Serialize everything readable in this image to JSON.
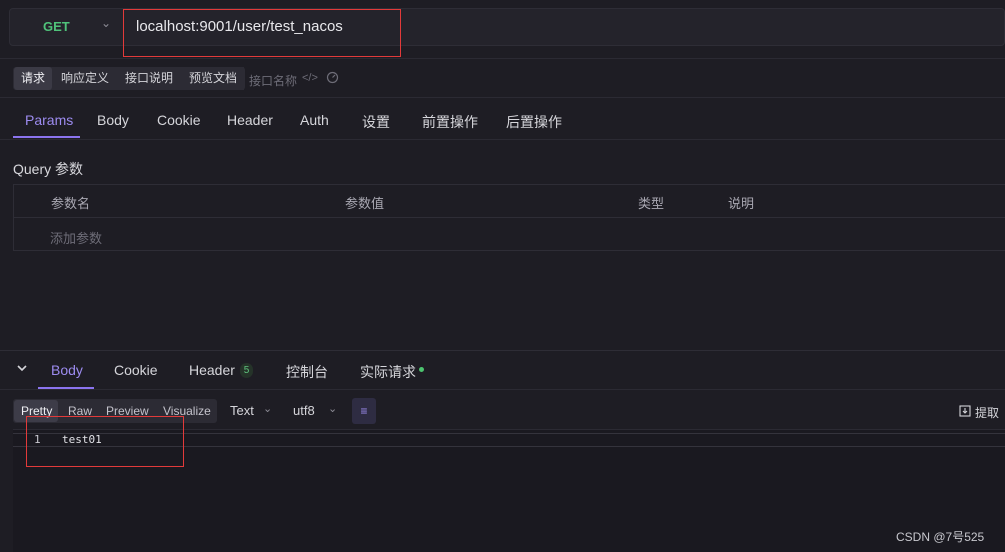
{
  "request": {
    "method": "GET",
    "url": "localhost:9001/user/test_nacos"
  },
  "subtabs": [
    "请求",
    "响应定义",
    "接口说明",
    "预览文档"
  ],
  "name_placeholder": "接口名称",
  "tabs": [
    "Params",
    "Body",
    "Cookie",
    "Header",
    "Auth",
    "设置",
    "前置操作",
    "后置操作"
  ],
  "query": {
    "title": "Query 参数",
    "columns": [
      "参数名",
      "参数值",
      "类型",
      "说明"
    ],
    "add_placeholder": "添加参数"
  },
  "response": {
    "tabs": [
      "Body",
      "Cookie",
      "Header",
      "控制台",
      "实际请求"
    ],
    "header_count": "5",
    "formats": [
      "Pretty",
      "Raw",
      "Preview",
      "Visualize"
    ],
    "type": "Text",
    "encoding": "utf8",
    "extract_label": "提取",
    "lines": [
      {
        "no": "1",
        "text": "test01"
      }
    ]
  },
  "watermark": "CSDN @7号525",
  "colors": {
    "accent": "#8b74ef",
    "method": "#4fc27a",
    "highlight_box": "#e23a3a"
  }
}
